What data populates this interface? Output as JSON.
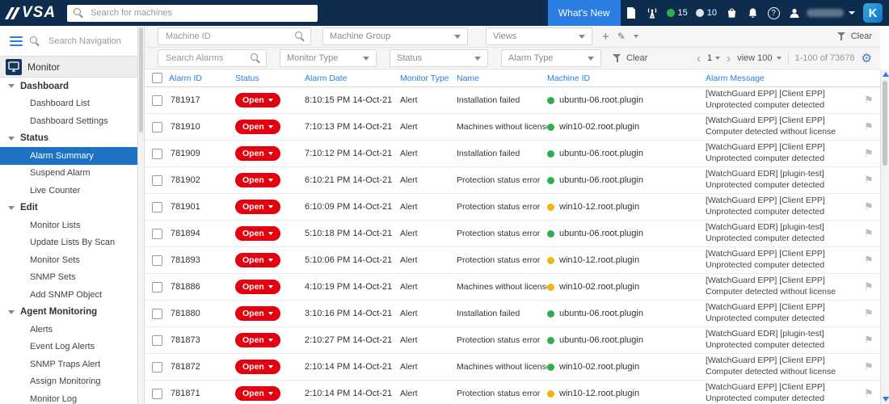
{
  "colors": {
    "topbar_bg": "#0d2c4e",
    "accent_blue": "#2a7de1",
    "open_red": "#e3000f",
    "status_green": "#2eaf4d",
    "status_yellow": "#f2b50e",
    "selected_nav_bg": "#1d72c2"
  },
  "topbar": {
    "logo": "VSA",
    "search_placeholder": "Search for machines",
    "whats_new_label": "What's New",
    "count_green": "15",
    "count_gray": "10",
    "kaseya_letter": "K"
  },
  "sidebar": {
    "search_placeholder": "Search Navigation",
    "module_label": "Monitor",
    "sections": [
      {
        "label": "Dashboard",
        "items": [
          {
            "label": "Dashboard List"
          },
          {
            "label": "Dashboard Settings"
          }
        ]
      },
      {
        "label": "Status",
        "items": [
          {
            "label": "Alarm Summary",
            "selected": true
          },
          {
            "label": "Suspend Alarm"
          },
          {
            "label": "Live Counter"
          }
        ]
      },
      {
        "label": "Edit",
        "items": [
          {
            "label": "Monitor Lists"
          },
          {
            "label": "Update Lists By Scan"
          },
          {
            "label": "Monitor Sets"
          },
          {
            "label": "SNMP Sets"
          },
          {
            "label": "Add SNMP Object"
          }
        ]
      },
      {
        "label": "Agent Monitoring",
        "items": [
          {
            "label": "Alerts"
          },
          {
            "label": "Event Log Alerts"
          },
          {
            "label": "SNMP Traps Alert"
          },
          {
            "label": "Assign Monitoring"
          },
          {
            "label": "Monitor Log"
          }
        ]
      }
    ]
  },
  "filters": {
    "machine_id_placeholder": "Machine ID",
    "machine_group_label": "Machine Group",
    "views_label": "Views",
    "clear_label": "Clear",
    "search_alarms_placeholder": "Search Alarms",
    "monitor_type_label": "Monitor Type",
    "status_label": "Status",
    "alarm_type_label": "Alarm Type",
    "clear2_label": "Clear",
    "page_number": "1",
    "view_label": "view 100",
    "range_label": "1-100 of 73678"
  },
  "table": {
    "headers": [
      "Alarm ID",
      "Status",
      "Alarm Date",
      "Monitor Type",
      "Name",
      "Machine ID",
      "Alarm Message"
    ],
    "rows": [
      {
        "id": "781917",
        "status": "Open",
        "date": "8:10:15 PM 14-Oct-21",
        "type": "Alert",
        "name": "Installation failed",
        "machine": "ubuntu-06.root.plugin",
        "machine_status": "green",
        "message": "[WatchGuard EPP] [Client EPP] Unprotected computer detected"
      },
      {
        "id": "781910",
        "status": "Open",
        "date": "7:10:13 PM 14-Oct-21",
        "type": "Alert",
        "name": "Machines without license (",
        "machine": "win10-02.root.plugin",
        "machine_status": "green",
        "message": "[WatchGuard EPP] [Client EPP] Computer detected without license"
      },
      {
        "id": "781909",
        "status": "Open",
        "date": "7:10:12 PM 14-Oct-21",
        "type": "Alert",
        "name": "Installation failed",
        "machine": "ubuntu-06.root.plugin",
        "machine_status": "green",
        "message": "[WatchGuard EPP] [Client EPP] Unprotected computer detected"
      },
      {
        "id": "781902",
        "status": "Open",
        "date": "6:10:21 PM 14-Oct-21",
        "type": "Alert",
        "name": "Protection status error",
        "machine": "ubuntu-06.root.plugin",
        "machine_status": "green",
        "message": "[WatchGuard EDR] [plugin-test] Unprotected computer detected"
      },
      {
        "id": "781901",
        "status": "Open",
        "date": "6:10:09 PM 14-Oct-21",
        "type": "Alert",
        "name": "Protection status error",
        "machine": "win10-12.root.plugin",
        "machine_status": "yellow",
        "message": "[WatchGuard EPP] [Client EPP] Unprotected computer detected"
      },
      {
        "id": "781894",
        "status": "Open",
        "date": "5:10:18 PM 14-Oct-21",
        "type": "Alert",
        "name": "Protection status error",
        "machine": "ubuntu-06.root.plugin",
        "machine_status": "green",
        "message": "[WatchGuard EDR] [plugin-test] Unprotected computer detected"
      },
      {
        "id": "781893",
        "status": "Open",
        "date": "5:10:06 PM 14-Oct-21",
        "type": "Alert",
        "name": "Protection status error",
        "machine": "win10-12.root.plugin",
        "machine_status": "yellow",
        "message": "[WatchGuard EPP] [Client EPP] Unprotected computer detected"
      },
      {
        "id": "781886",
        "status": "Open",
        "date": "4:10:19 PM 14-Oct-21",
        "type": "Alert",
        "name": "Machines without license (",
        "machine": "win10-02.root.plugin",
        "machine_status": "yellow",
        "message": "[WatchGuard EPP] [Client EPP] Computer detected without license"
      },
      {
        "id": "781880",
        "status": "Open",
        "date": "3:10:16 PM 14-Oct-21",
        "type": "Alert",
        "name": "Installation failed",
        "machine": "ubuntu-06.root.plugin",
        "machine_status": "green",
        "message": "[WatchGuard EPP] [Client EPP] Unprotected computer detected"
      },
      {
        "id": "781873",
        "status": "Open",
        "date": "2:10:27 PM 14-Oct-21",
        "type": "Alert",
        "name": "Protection status error",
        "machine": "ubuntu-06.root.plugin",
        "machine_status": "green",
        "message": "[WatchGuard EDR] [plugin-test] Unprotected computer detected"
      },
      {
        "id": "781872",
        "status": "Open",
        "date": "2:10:14 PM 14-Oct-21",
        "type": "Alert",
        "name": "Machines without license (",
        "machine": "win10-02.root.plugin",
        "machine_status": "green",
        "message": "[WatchGuard EPP] [Client EPP] Computer detected without license"
      },
      {
        "id": "781871",
        "status": "Open",
        "date": "2:10:14 PM 14-Oct-21",
        "type": "Alert",
        "name": "Protection status error",
        "machine": "win10-12.root.plugin",
        "machine_status": "yellow",
        "message": "[WatchGuard EPP] [Client EPP] Unprotected computer detected"
      }
    ]
  }
}
